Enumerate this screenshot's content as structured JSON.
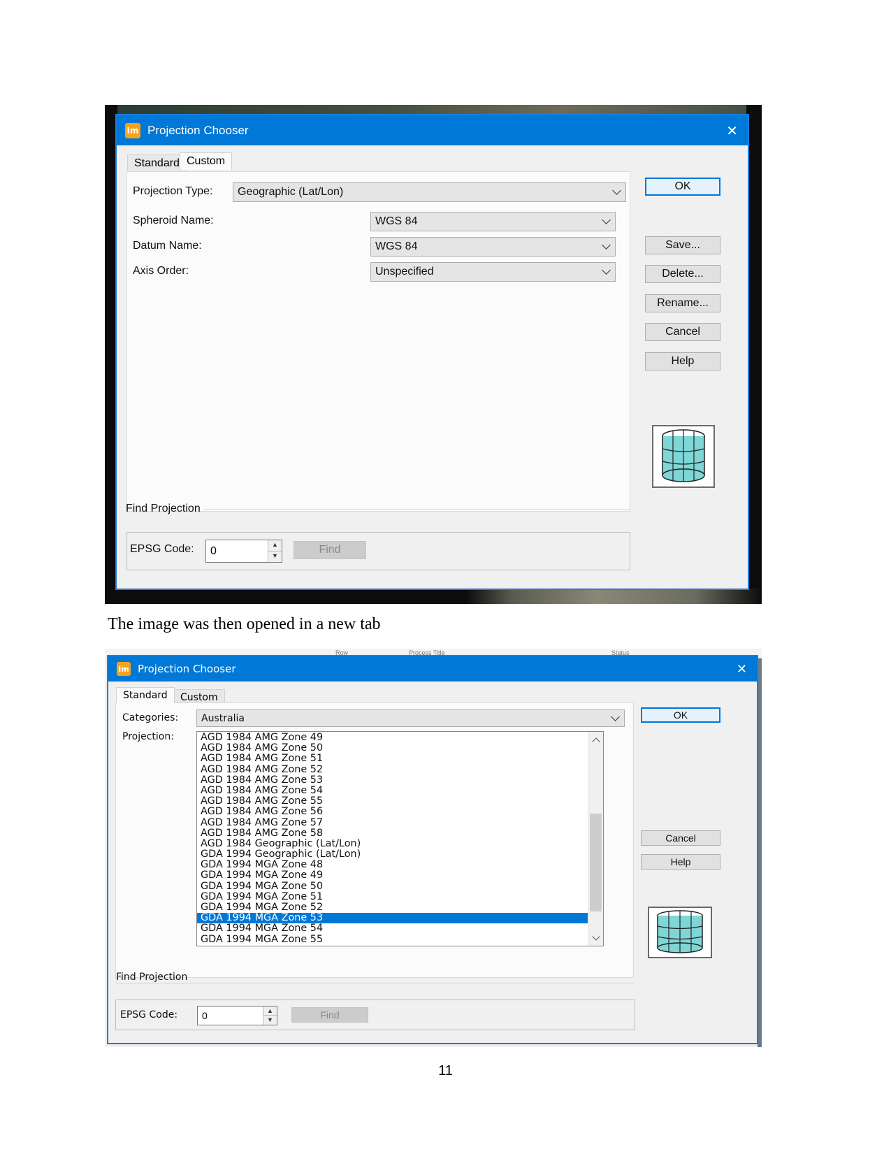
{
  "dialog1": {
    "title": "Projection Chooser",
    "app_icon_text": "Im",
    "close_glyph": "✕",
    "tabs": [
      "Standard",
      "Custom"
    ],
    "labels": {
      "projection_type": "Projection Type:",
      "spheroid_name": "Spheroid Name:",
      "datum_name": "Datum Name:",
      "axis_order": "Axis Order:"
    },
    "values": {
      "projection_type": "Geographic (Lat/Lon)",
      "spheroid_name": "WGS 84",
      "datum_name": "WGS 84",
      "axis_order": "Unspecified"
    },
    "buttons": {
      "ok": "OK",
      "save": "Save...",
      "delete": "Delete...",
      "rename": "Rename...",
      "cancel": "Cancel",
      "help": "Help"
    },
    "find": {
      "section_title": "Find Projection",
      "epsg_label": "EPSG Code:",
      "epsg_value": "0",
      "find_button": "Find"
    }
  },
  "caption": "The image was then opened in a new tab",
  "background_header": {
    "col_row": "Row",
    "col_process_title": "Process Title",
    "col_status": "Status"
  },
  "dialog2": {
    "title": "Projection Chooser",
    "app_icon_text": "Im",
    "close_glyph": "✕",
    "tabs": [
      "Standard",
      "Custom"
    ],
    "labels": {
      "categories": "Categories:",
      "projection": "Projection:"
    },
    "categories_value": "Australia",
    "projections": [
      "AGD 1984 AMG Zone 49",
      "AGD 1984 AMG Zone 50",
      "AGD 1984 AMG Zone 51",
      "AGD 1984 AMG Zone 52",
      "AGD 1984 AMG Zone 53",
      "AGD 1984 AMG Zone 54",
      "AGD 1984 AMG Zone 55",
      "AGD 1984 AMG Zone 56",
      "AGD 1984 AMG Zone 57",
      "AGD 1984 AMG Zone 58",
      "AGD 1984 Geographic (Lat/Lon)",
      "GDA 1994 Geographic (Lat/Lon)",
      "GDA 1994 MGA Zone 48",
      "GDA 1994 MGA Zone 49",
      "GDA 1994 MGA Zone 50",
      "GDA 1994 MGA Zone 51",
      "GDA 1994 MGA Zone 52",
      "GDA 1994 MGA Zone 53",
      "GDA 1994 MGA Zone 54",
      "GDA 1994 MGA Zone 55"
    ],
    "selected_projection": "GDA 1994 MGA Zone 53",
    "buttons": {
      "ok": "OK",
      "cancel": "Cancel",
      "help": "Help"
    },
    "find": {
      "section_title": "Find Projection",
      "epsg_label": "EPSG Code:",
      "epsg_value": "0",
      "find_button": "Find"
    }
  },
  "page_number": "11",
  "colors": {
    "titlebar": "#0078d7",
    "selection": "#0078d7",
    "app_icon": "#f7a21b",
    "globe_fill": "#7fd6d6"
  }
}
